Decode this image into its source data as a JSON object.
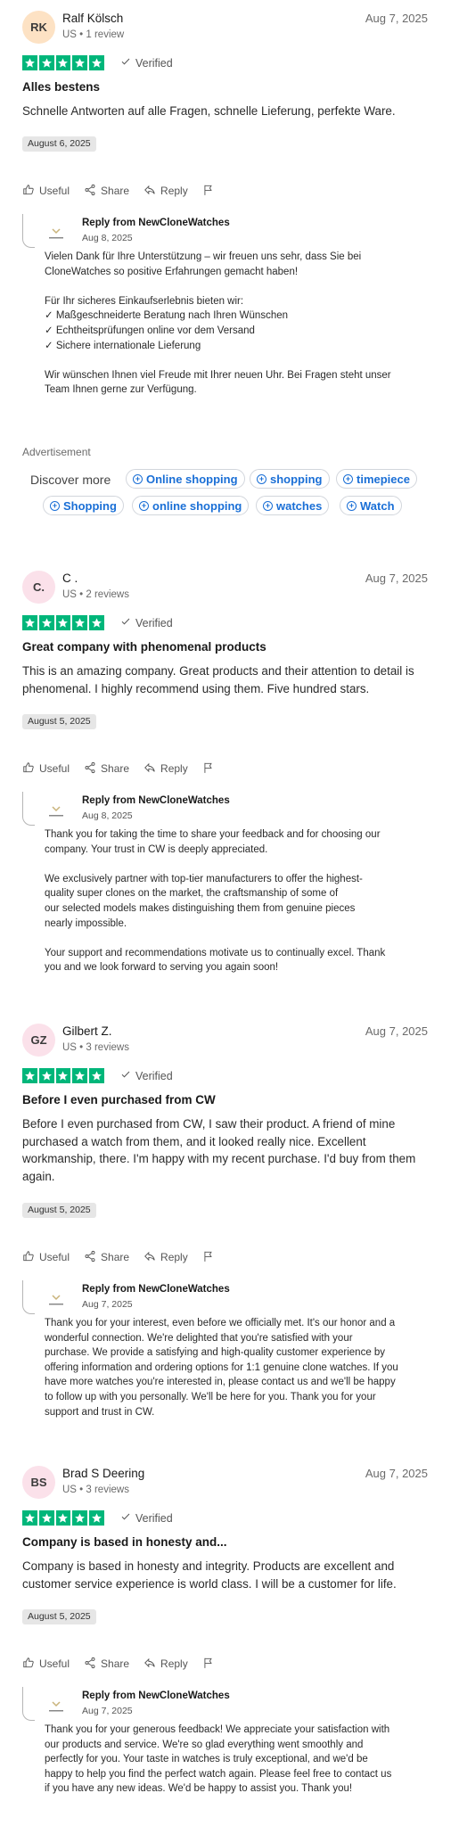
{
  "common": {
    "verified": "Verified",
    "useful": "Useful",
    "share": "Share",
    "reply": "Reply",
    "reply_from": "Reply from NewCloneWatches",
    "star_color": "#00b67a"
  },
  "reviews": [
    {
      "initials": "RK",
      "avatar_color": "#fde2c4",
      "name": "Ralf Kölsch",
      "meta": "US • 1 review",
      "date": "Aug 7, 2025",
      "rating": 5,
      "title": "Alles bestens",
      "body": "Schnelle Antworten auf alle Fragen, schnelle Lieferung, perfekte Ware.",
      "experience_date": "August 6, 2025",
      "reply_date": "Aug 8, 2025",
      "reply_text": "Vielen Dank für Ihre Unterstützung – wir freuen uns sehr, dass Sie bei\nCloneWatches so positive Erfahrungen gemacht haben!\n\nFür Ihr sicheres Einkaufserlebnis bieten wir:\n✓ Maßgeschneiderte Beratung nach Ihren Wünschen\n✓ Echtheitsprüfungen online vor dem Versand\n✓ Sichere internationale Lieferung\n\nWir wünschen Ihnen viel Freude mit Ihrer neuen Uhr. Bei Fragen steht unser\nTeam Ihnen gerne zur Verfügung."
    },
    {
      "initials": "C.",
      "avatar_color": "#fbe1ea",
      "name": "C .",
      "meta": "US • 2 reviews",
      "date": "Aug 7, 2025",
      "rating": 5,
      "title": "Great company with phenomenal products",
      "body": "This is an amazing company. Great products and their attention to detail is phenomenal. I highly recommend using them. Five hundred stars.",
      "experience_date": "August 5, 2025",
      "reply_date": "Aug 8, 2025",
      "reply_text": "Thank you for taking the time to share your feedback and for choosing our\ncompany. Your trust in CW is deeply appreciated.\n\nWe exclusively partner with top-tier manufacturers to offer the highest-\nquality super clones on the market, the craftsmanship of some of\nour selected models makes distinguishing them from genuine pieces\nnearly impossible.\n\nYour support and recommendations motivate us to continually excel. Thank\nyou and we look forward to serving you again soon!"
    },
    {
      "initials": "GZ",
      "avatar_color": "#fbe1ea",
      "name": "Gilbert Z.",
      "meta": "US • 3 reviews",
      "date": "Aug 7, 2025",
      "rating": 5,
      "title": "Before I even purchased from CW",
      "body": "Before I even purchased from CW, I saw their product. A friend of mine purchased a watch from them, and it looked really nice. Excellent workmanship, there. I'm happy with my recent purchase. I'd buy from them again.",
      "experience_date": "August 5, 2025",
      "reply_date": "Aug 7, 2025",
      "reply_text": "Thank you for your interest, even before we officially met. It's our honor and a\nwonderful connection. We're delighted that you're satisfied with your\npurchase. We provide a satisfying and high-quality customer experience by\noffering information and ordering options for 1:1 genuine clone watches. If you\nhave more watches you're interested in, please contact us and we'll be happy\nto follow up with you personally. We'll be here for you. Thank you for your\nsupport and trust in CW."
    },
    {
      "initials": "BS",
      "avatar_color": "#fbe1ea",
      "name": "Brad S Deering",
      "meta": "US • 3 reviews",
      "date": "Aug 7, 2025",
      "rating": 5,
      "title": "Company is based in honesty and...",
      "body": "Company is based in honesty and integrity. Products are excellent and customer service experience is world class. I will be a customer for life.",
      "experience_date": "August 5, 2025",
      "reply_date": "Aug 7, 2025",
      "reply_text": "Thank you for your generous feedback! We appreciate your satisfaction with\nour products and service. We're so glad everything went smoothly and\nperfectly for you. Your taste in watches is truly exceptional, and we'd be\nhappy to help you find the perfect watch again. Please feel free to contact us\nif you have any new ideas. We'd be happy to assist you. Thank you!"
    }
  ],
  "ad": {
    "label": "Advertisement",
    "discover": "Discover more",
    "chips": [
      "Online shopping",
      "shopping",
      "timepiece",
      "Shopping",
      "online shopping",
      "watches",
      "Watch"
    ]
  }
}
